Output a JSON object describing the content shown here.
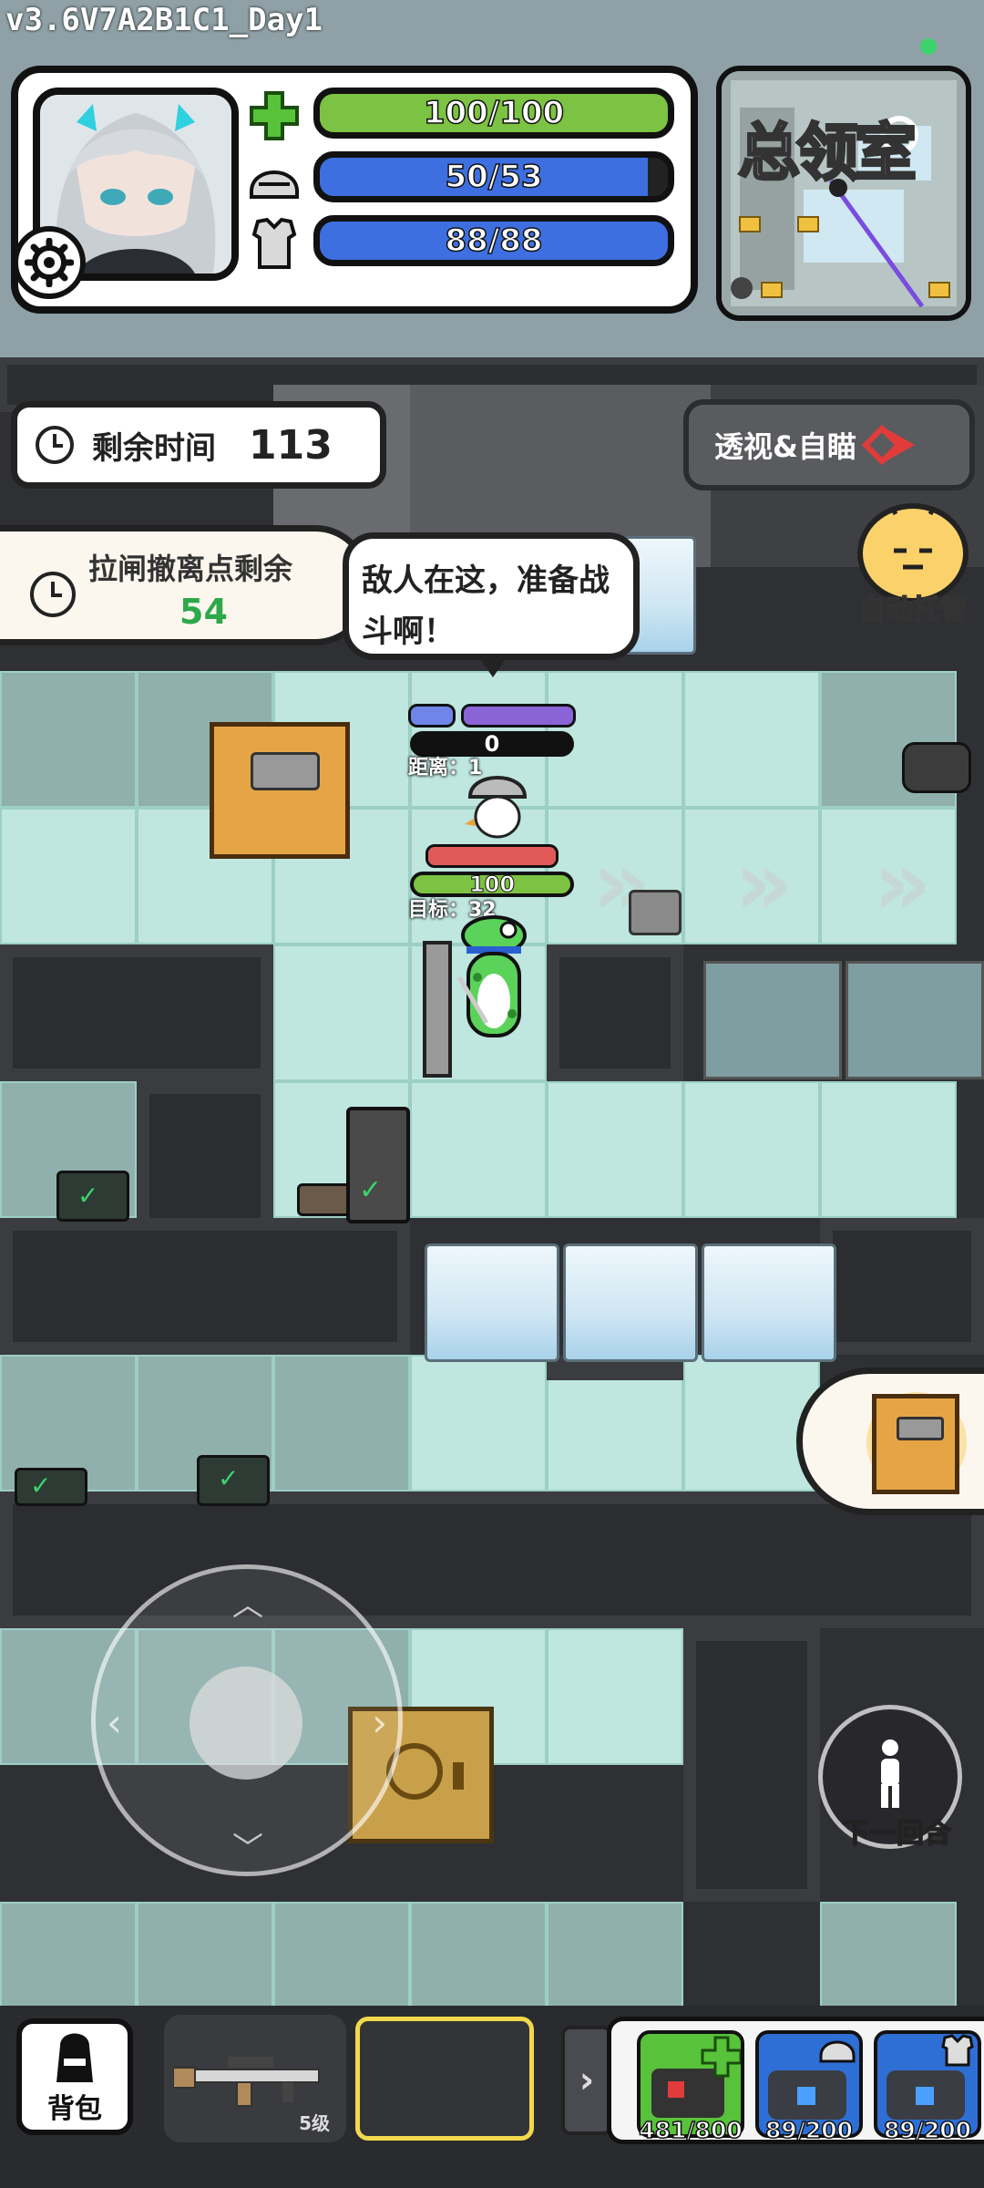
{
  "build": {
    "version": "v3.6V7A2B1C1_Day1"
  },
  "status": {
    "hp": {
      "text": "100/100",
      "current": 100,
      "max": 100,
      "color": "#7cc243"
    },
    "helmet": {
      "text": "50/53",
      "current": 50,
      "max": 53,
      "color": "#3e6fe0"
    },
    "armor": {
      "text": "88/88",
      "current": 88,
      "max": 88,
      "color": "#3e6fe0"
    }
  },
  "minimap": {
    "watermark": "总领室"
  },
  "hud": {
    "timer": {
      "label": "剩余时间",
      "value": "113"
    },
    "evac": {
      "label": "拉闸撤离点剩余",
      "value": "54"
    },
    "xray_button": "透视&自瞄",
    "auto_button": "自动托管",
    "next_round": "下一回合"
  },
  "enemy": {
    "speech": "敌人在这，准备战斗啊！",
    "ammo": "0",
    "distance_label": "距离：1"
  },
  "player": {
    "hp": "100",
    "target_label": "目标：32"
  },
  "bottom": {
    "backpack_label": "背包",
    "weapon_level": "5级",
    "toggle_glyph": "›",
    "quick_items": [
      {
        "name": "medkit",
        "count": "481/800",
        "color": "#58c23a"
      },
      {
        "name": "helmet-repair-kit",
        "count": "89/200",
        "color": "#2e6fd6"
      },
      {
        "name": "armor-repair-kit",
        "count": "89/200",
        "color": "#2e6fd6"
      }
    ]
  }
}
